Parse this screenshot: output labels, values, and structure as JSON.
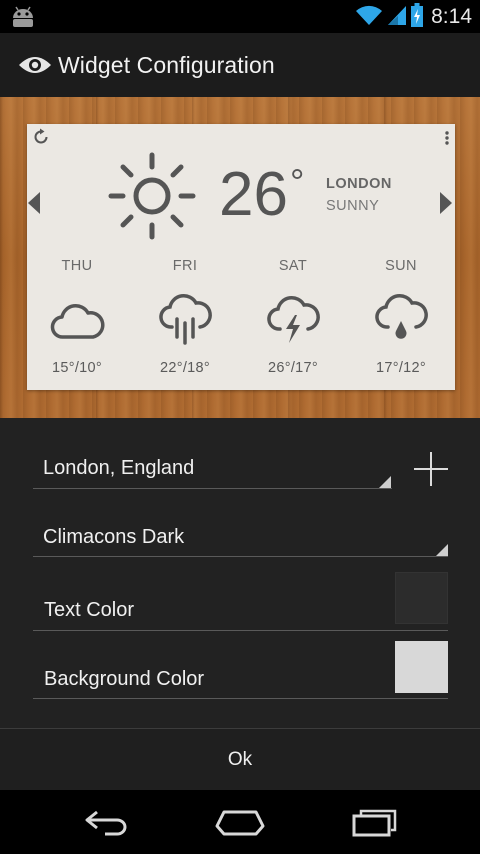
{
  "status_bar": {
    "time": "8:14"
  },
  "action_bar": {
    "title": "Widget Configuration"
  },
  "widget": {
    "temperature": "26",
    "degree_symbol": "°",
    "city": "LONDON",
    "condition": "SUNNY",
    "forecast": [
      {
        "day": "THU",
        "icon": "cloud-icon",
        "range": "15°/10°"
      },
      {
        "day": "FRI",
        "icon": "rain-icon",
        "range": "22°/18°"
      },
      {
        "day": "SAT",
        "icon": "thunderstorm-icon",
        "range": "26°/17°"
      },
      {
        "day": "SUN",
        "icon": "hail-icon",
        "range": "17°/12°"
      }
    ]
  },
  "form": {
    "location": "London, England",
    "icon_set": "Climacons Dark",
    "text_color_label": "Text Color",
    "background_color_label": "Background Color",
    "text_color_value": "#2c2c2c",
    "background_color_value": "#d8d8d8"
  },
  "ok_label": "Ok"
}
